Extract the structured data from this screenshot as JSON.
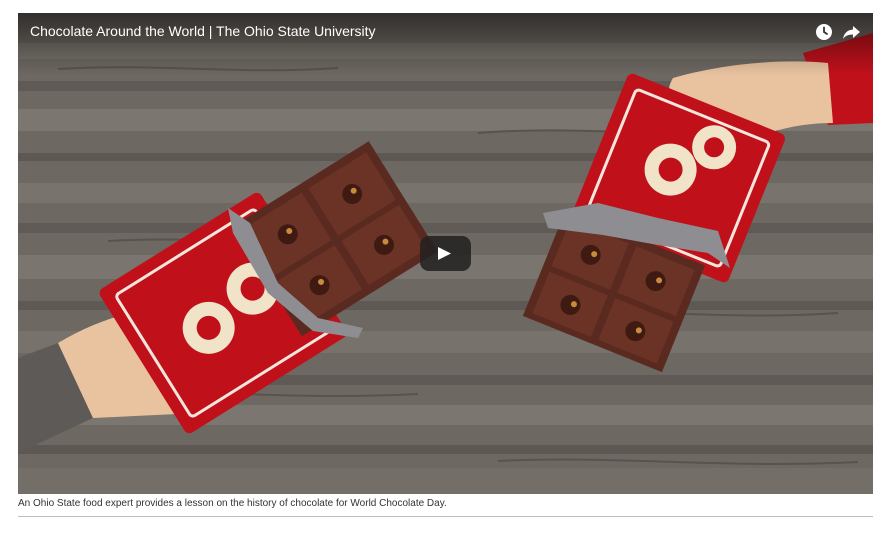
{
  "video": {
    "title": "Chocolate Around the World | The Ohio State University",
    "controls": {
      "watch_later_icon": "clock-icon",
      "share_icon": "share-arrow-icon",
      "play_icon": "play-icon"
    },
    "colors": {
      "wrapper_red": "#c0111b",
      "chocolate": "#5a2a20",
      "skin": "#e9c3a0",
      "wood": "#6f6a64"
    }
  },
  "caption": {
    "text": "An Ohio State food expert provides a lesson on the history of chocolate for World Chocolate Day."
  }
}
